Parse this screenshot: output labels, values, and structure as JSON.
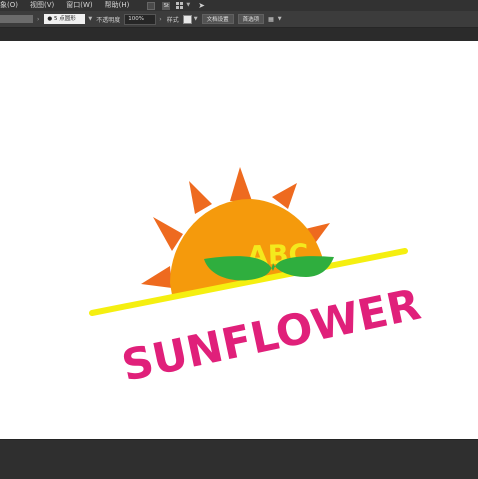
{
  "menubar": {
    "items": [
      {
        "label": "象(O)"
      },
      {
        "label": "视图(V)"
      },
      {
        "label": "窗口(W)"
      },
      {
        "label": "帮助(H)"
      }
    ],
    "stock_label": "St",
    "icons": [
      "workspace-icon",
      "stock-icon",
      "arrange-grid-icon",
      "chevron-down-icon",
      "rocket-icon"
    ]
  },
  "controlbar": {
    "brush": "5 点圆形",
    "opacity_label": "不透明度",
    "opacity_value": "100%",
    "style_label": "样式",
    "document_setup": "文档设置",
    "preferences": "首选项"
  },
  "artwork": {
    "top_text": "ABC",
    "main_text": "SUNFLOWER",
    "colors": {
      "sun": "#f59a0c",
      "petals": "#ee6a1f",
      "abc": "#f4e91d",
      "leaf": "#2fae3e",
      "line": "#f5ef10",
      "text": "#e0207a"
    }
  }
}
